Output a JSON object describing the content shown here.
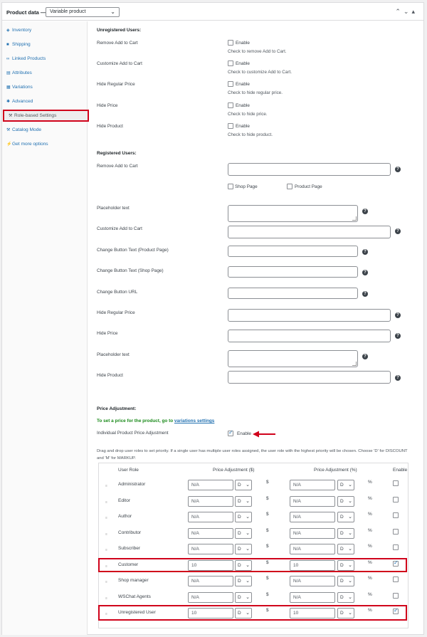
{
  "header": {
    "title": "Product data —",
    "product_type": "Variable product",
    "icons": [
      "chevron-up-icon",
      "chevron-down-icon",
      "collapse-icon"
    ]
  },
  "sidebar": {
    "items": [
      {
        "label": "Inventory",
        "icon": "inventory-icon"
      },
      {
        "label": "Shipping",
        "icon": "truck-icon"
      },
      {
        "label": "Linked Products",
        "icon": "link-icon"
      },
      {
        "label": "Attributes",
        "icon": "list-icon"
      },
      {
        "label": "Variations",
        "icon": "grid-icon"
      },
      {
        "label": "Advanced",
        "icon": "gear-icon"
      },
      {
        "label": "Role-based Settings",
        "icon": "wrench-icon",
        "active": true
      },
      {
        "label": "Catalog Mode",
        "icon": "wrench-icon"
      },
      {
        "label": "Get more options",
        "icon": "plugin-icon"
      }
    ]
  },
  "unregistered": {
    "title": "Unregistered Users:",
    "rows": [
      {
        "label": "Remove Add to Cart",
        "cb_label": "Enable",
        "hint": "Check to remove Add to Cart."
      },
      {
        "label": "Customize Add to Cart",
        "cb_label": "Enable",
        "hint": "Check to customize Add to Cart."
      },
      {
        "label": "Hide Regular Price",
        "cb_label": "Enable",
        "hint": "Check to hide regular price."
      },
      {
        "label": "Hide Price",
        "cb_label": "Enable",
        "hint": "Check to hide price."
      },
      {
        "label": "Hide Product",
        "cb_label": "Enable",
        "hint": "Check to hide product."
      }
    ]
  },
  "registered": {
    "title": "Registered Users:",
    "remove_add_to_cart": "Remove Add to Cart",
    "shop_page": "Shop Page",
    "product_page": "Product Page",
    "placeholder_text": "Placeholder text",
    "customize_add_to_cart": "Customize Add to Cart",
    "change_btn_product": "Change Button Text (Product Page)",
    "change_btn_shop": "Change Button Text (Shop Page)",
    "change_btn_url": "Change Button URL",
    "hide_regular_price": "Hide Regular Price",
    "hide_price": "Hide Price",
    "placeholder_text_2": "Placeholder text",
    "hide_product": "Hide Product"
  },
  "price_adjustment": {
    "title": "Price Adjustment:",
    "notice": "To set a price for the product, go to",
    "notice_link": "variations settings",
    "individual_label": "Individual Product Price Adjustment",
    "individual_enable": "Enable",
    "individual_checked": true,
    "instructions_1": "Drag and drop user roles to set priority. If a single user has multiple user roles assigned, the user role with the highest priority will be chosen. Choose 'D' for DISCOUNT",
    "instructions_2": "and 'M' for MARKUP.",
    "columns": {
      "role": "User Role",
      "fixed": "Price Adjustment ($)",
      "percent": "Price Adjustment (%)",
      "enable": "Enable"
    },
    "currency_symbol": "$",
    "percent_symbol": "%",
    "placeholder": "N/A",
    "rows": [
      {
        "role": "Administrator",
        "fixed": "",
        "fixed_type": "D",
        "percent": "",
        "percent_type": "D",
        "enabled": false
      },
      {
        "role": "Editor",
        "fixed": "",
        "fixed_type": "D",
        "percent": "",
        "percent_type": "D",
        "enabled": false
      },
      {
        "role": "Author",
        "fixed": "",
        "fixed_type": "D",
        "percent": "",
        "percent_type": "D",
        "enabled": false
      },
      {
        "role": "Contributor",
        "fixed": "",
        "fixed_type": "D",
        "percent": "",
        "percent_type": "D",
        "enabled": false
      },
      {
        "role": "Subscriber",
        "fixed": "",
        "fixed_type": "D",
        "percent": "",
        "percent_type": "D",
        "enabled": false
      },
      {
        "role": "Customer",
        "fixed": "10",
        "fixed_type": "D",
        "percent": "10",
        "percent_type": "D",
        "enabled": true,
        "highlight": true
      },
      {
        "role": "Shop manager",
        "fixed": "",
        "fixed_type": "D",
        "percent": "",
        "percent_type": "D",
        "enabled": false
      },
      {
        "role": "WSChat Agents",
        "fixed": "",
        "fixed_type": "D",
        "percent": "",
        "percent_type": "D",
        "enabled": false
      },
      {
        "role": "Unregistered User",
        "fixed": "10",
        "fixed_type": "D",
        "percent": "10",
        "percent_type": "D",
        "enabled": true,
        "highlight": true
      }
    ]
  },
  "colors": {
    "accent": "#2271b1",
    "highlight": "#d0021b",
    "notice": "#1a8a1a"
  }
}
